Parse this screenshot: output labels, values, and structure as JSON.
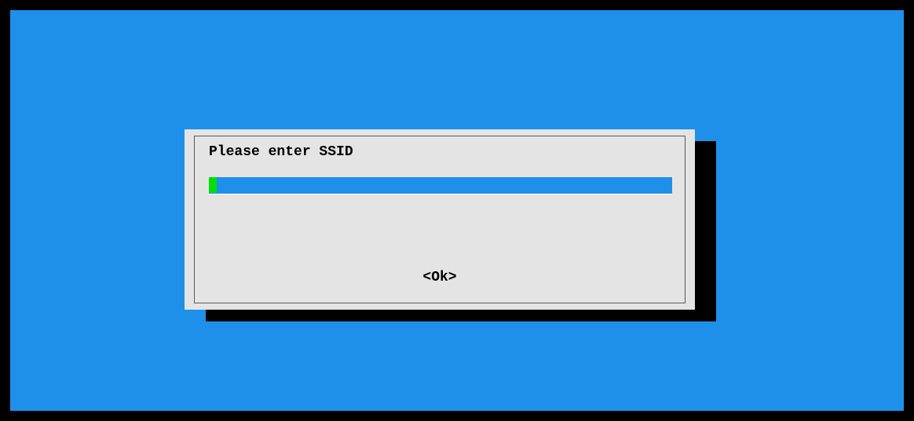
{
  "dialog": {
    "prompt": "Please enter SSID",
    "input_value": "",
    "ok_label": "<Ok>"
  }
}
